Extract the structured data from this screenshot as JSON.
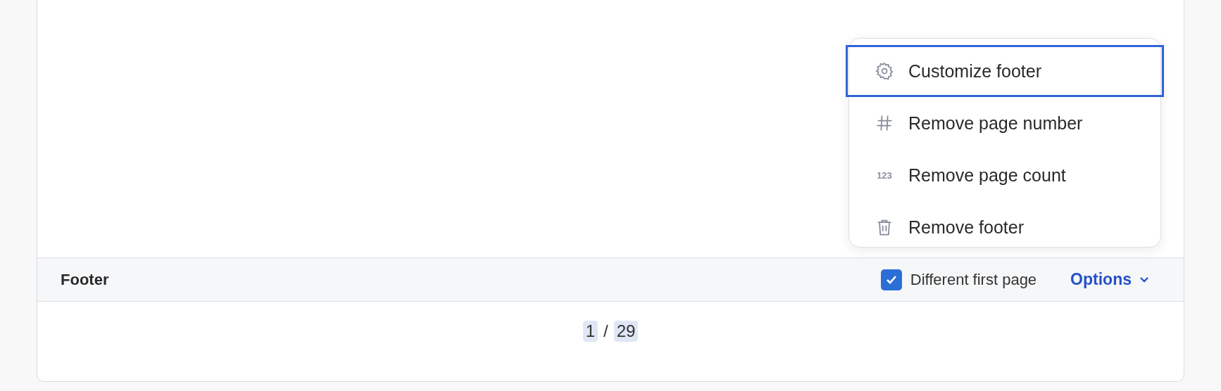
{
  "menu": {
    "items": [
      {
        "kind": "gear",
        "label": "Customize footer",
        "selected": true
      },
      {
        "kind": "hash",
        "label": "Remove page number",
        "selected": false
      },
      {
        "kind": "digits",
        "icon_text": "123",
        "label": "Remove page count",
        "selected": false
      },
      {
        "kind": "trash",
        "label": "Remove footer",
        "selected": false
      }
    ]
  },
  "footer_bar": {
    "title": "Footer",
    "different_first_page": {
      "label": "Different first page",
      "checked": true
    },
    "options": {
      "label": "Options"
    }
  },
  "page_number": {
    "current": "1",
    "separator": "/",
    "total": "29"
  }
}
